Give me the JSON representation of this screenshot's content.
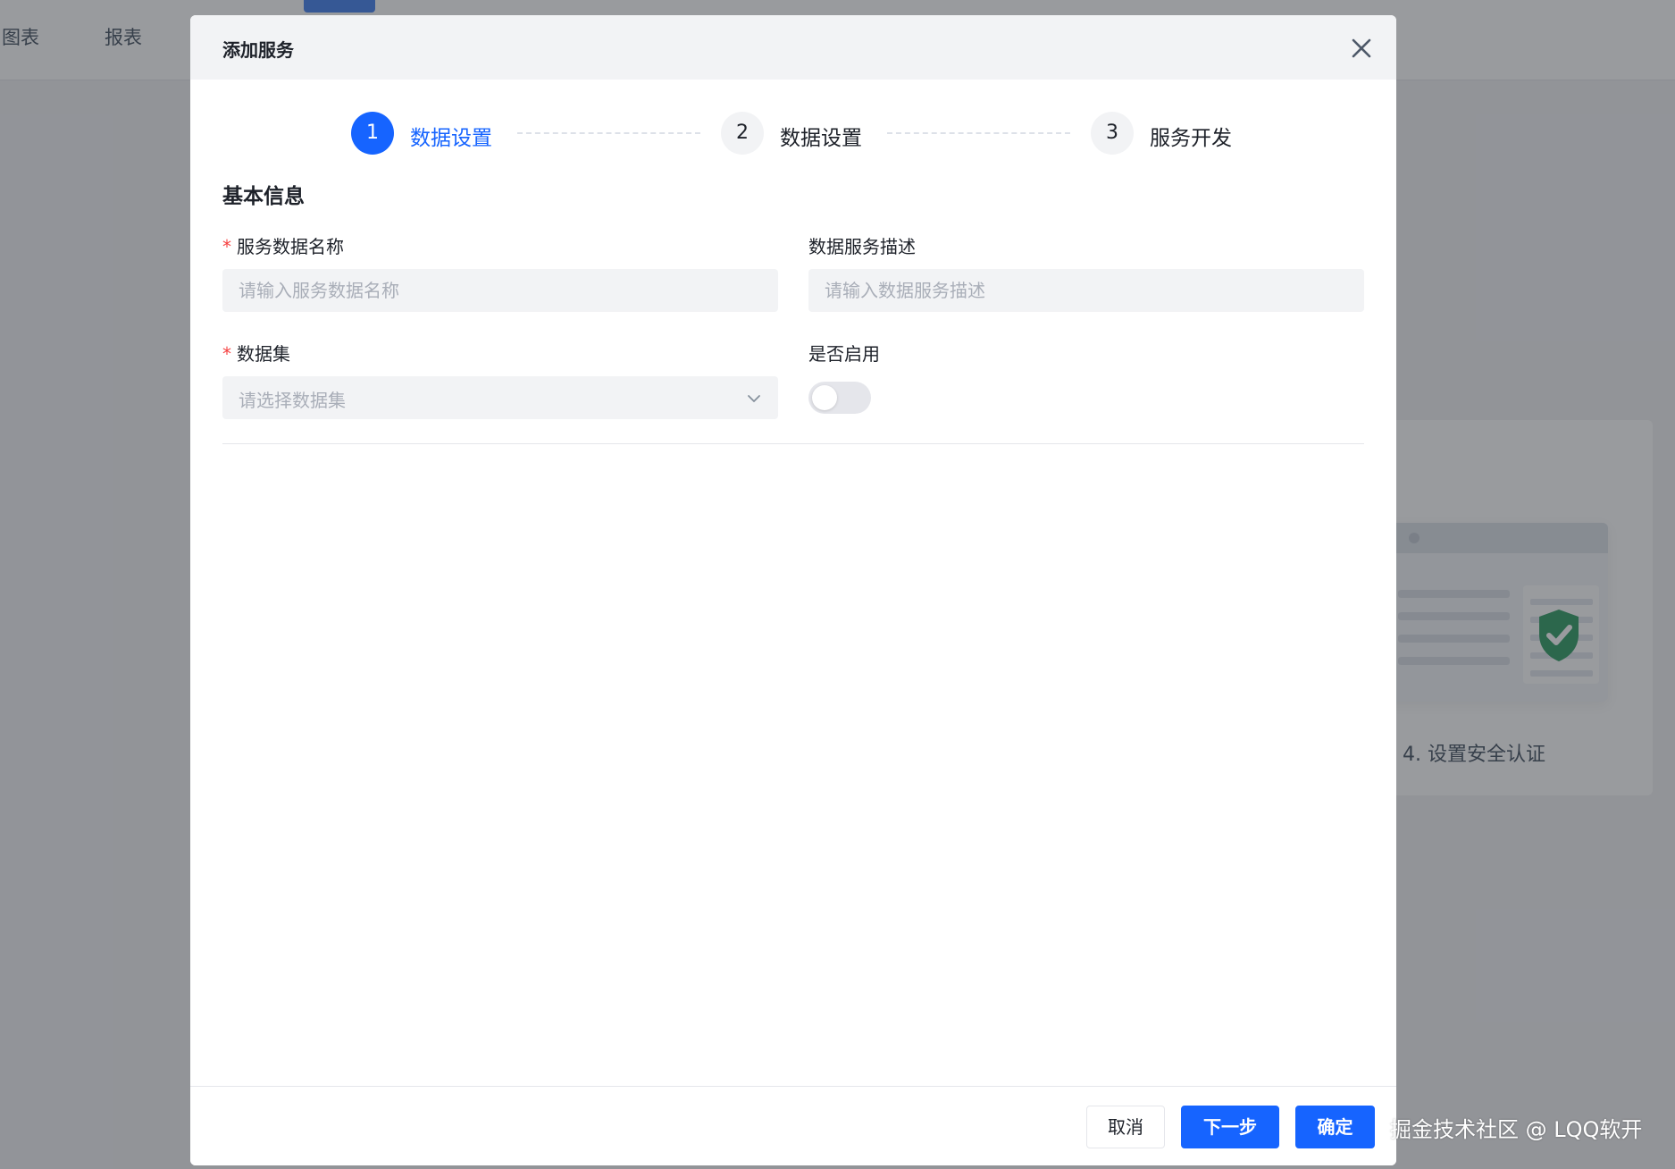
{
  "background": {
    "tabs": [
      "图表",
      "报表"
    ],
    "step4_label": "4. 设置安全认证"
  },
  "modal": {
    "title": "添加服务",
    "steps": [
      {
        "number": "1",
        "label": "数据设置",
        "state": "active"
      },
      {
        "number": "2",
        "label": "数据设置",
        "state": "idle"
      },
      {
        "number": "3",
        "label": "服务开发",
        "state": "idle"
      }
    ],
    "section_title": "基本信息",
    "fields": {
      "name": {
        "label": "服务数据名称",
        "required": true,
        "value": "",
        "placeholder": "请输入服务数据名称"
      },
      "description": {
        "label": "数据服务描述",
        "required": false,
        "value": "",
        "placeholder": "请输入数据服务描述"
      },
      "dataset": {
        "label": "数据集",
        "required": true,
        "placeholder": "请选择数据集"
      },
      "enabled": {
        "label": "是否启用",
        "value": false
      }
    },
    "footer": {
      "cancel_label": "取消",
      "next_label": "下一步",
      "confirm_label": "确定"
    }
  },
  "watermark": "掘金技术社区 @ LQQ软开",
  "colors": {
    "primary": "#1664ff",
    "required": "#f53f3f",
    "input_bg": "#f2f3f5"
  }
}
